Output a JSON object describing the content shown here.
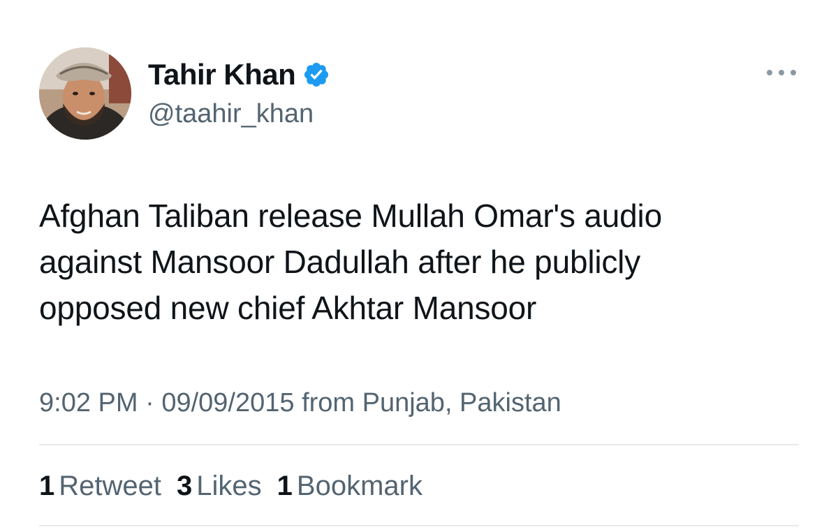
{
  "author": {
    "display_name": "Tahir Khan",
    "handle": "@taahir_khan",
    "verified": true
  },
  "tweet": {
    "text": "Afghan Taliban release Mullah Omar's audio\nagainst Mansoor Dadullah after he publicly\nopposed new chief Akhtar Mansoor"
  },
  "meta": {
    "time": "9:02 PM",
    "separator": "·",
    "date": "09/09/2015",
    "location": "from Punjab, Pakistan"
  },
  "stats": [
    {
      "count": "1",
      "label": "Retweet"
    },
    {
      "count": "3",
      "label": "Likes"
    },
    {
      "count": "1",
      "label": "Bookmark"
    }
  ],
  "colors": {
    "verified_blue": "#1d9bf0",
    "secondary_text": "#536471",
    "primary_text": "#0f1419",
    "divider": "#e7eaec"
  },
  "icons": {
    "verified": "verified-badge-icon",
    "more": "more-options-icon"
  }
}
